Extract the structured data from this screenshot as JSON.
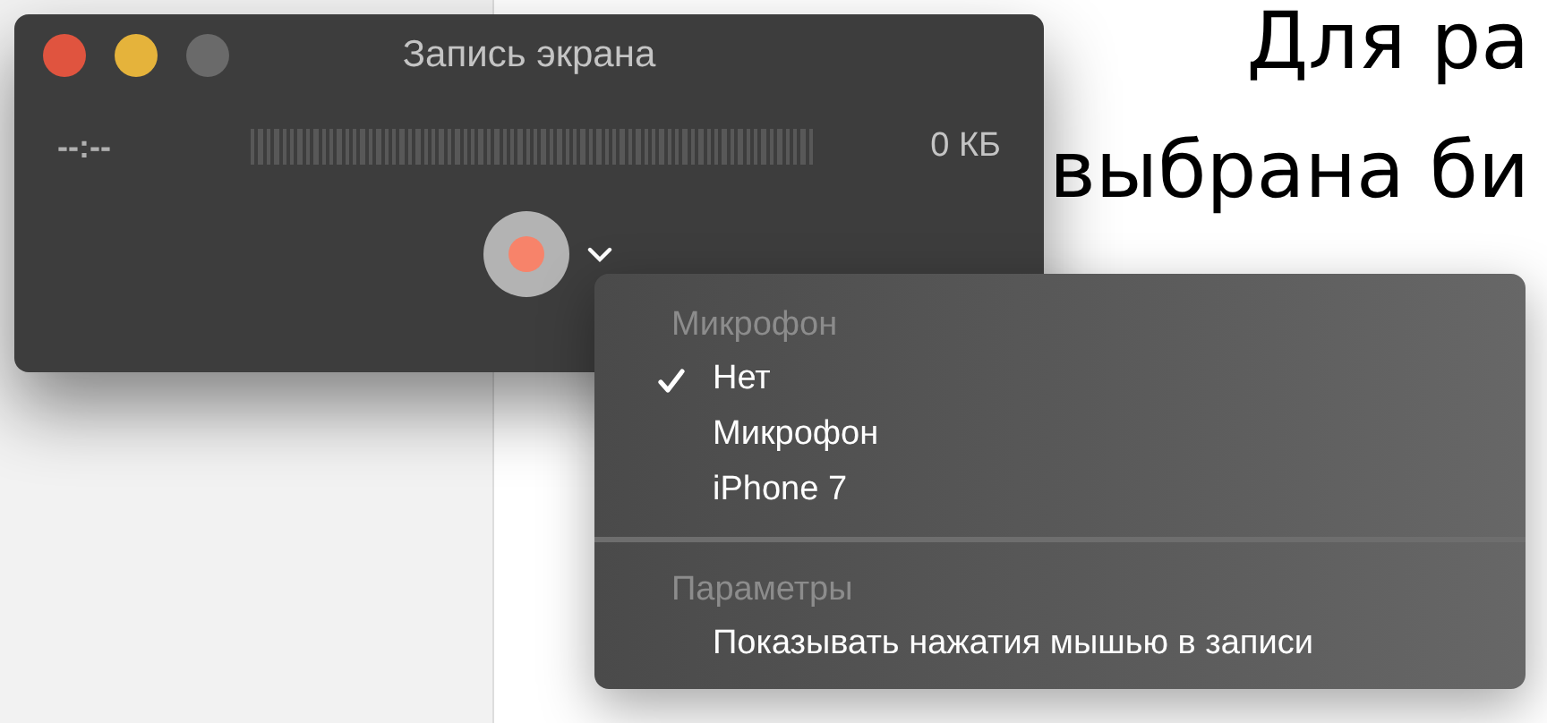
{
  "document": {
    "lines": [
      "Для ра",
      "выбрана би"
    ]
  },
  "window": {
    "title": "Запись экрана",
    "elapsed": "--:--",
    "file_size": "0 КБ"
  },
  "menu": {
    "sections": [
      {
        "header": "Микрофон",
        "items": [
          {
            "label": "Нет",
            "checked": true
          },
          {
            "label": "Микрофон",
            "checked": false
          },
          {
            "label": "iPhone 7",
            "checked": false
          }
        ]
      },
      {
        "header": "Параметры",
        "items": [
          {
            "label": "Показывать нажатия мышью в записи",
            "checked": false
          }
        ]
      }
    ]
  }
}
